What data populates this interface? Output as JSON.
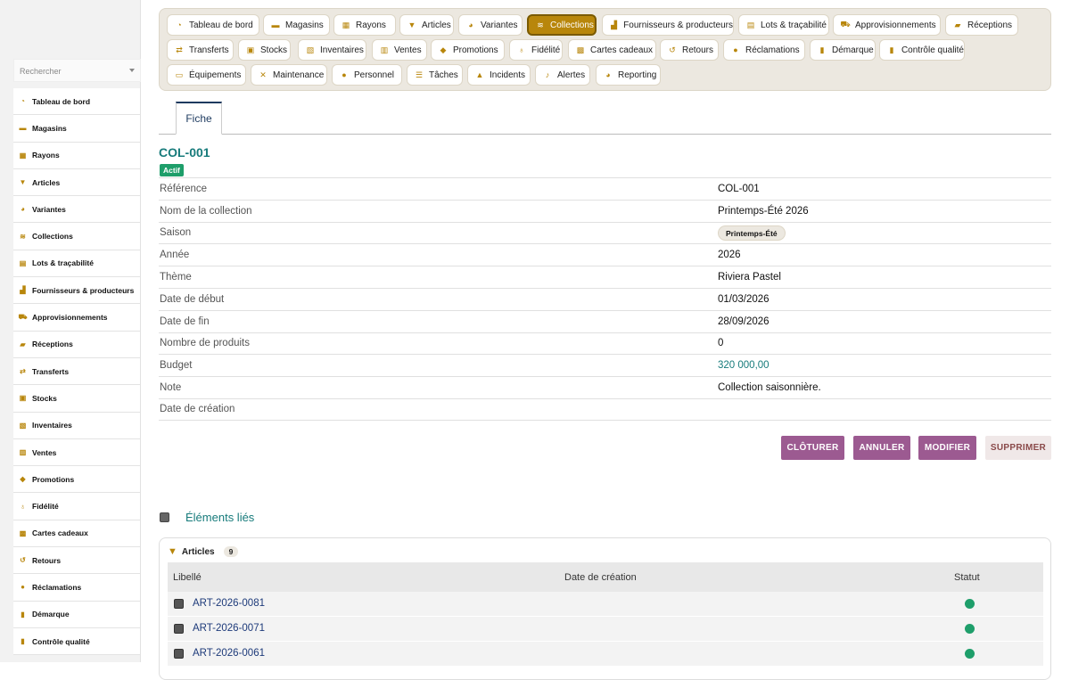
{
  "sidebar": {
    "search_placeholder": "Rechercher",
    "items": [
      {
        "label": "Tableau de bord",
        "icon": "gauge-icon",
        "glyph": "◔"
      },
      {
        "label": "Magasins",
        "icon": "store-icon",
        "glyph": "▬"
      },
      {
        "label": "Rayons",
        "icon": "grid-icon",
        "glyph": "▦"
      },
      {
        "label": "Articles",
        "icon": "shirt-icon",
        "glyph": "▼"
      },
      {
        "label": "Variantes",
        "icon": "palette-icon",
        "glyph": "◕"
      },
      {
        "label": "Collections",
        "icon": "layers-icon",
        "glyph": "≋"
      },
      {
        "label": "Lots & traçabilité",
        "icon": "barcode-icon",
        "glyph": "▤"
      },
      {
        "label": "Fournisseurs & producteurs",
        "icon": "factory-icon",
        "glyph": "▟"
      },
      {
        "label": "Approvisionnements",
        "icon": "cart-icon",
        "glyph": "⛟"
      },
      {
        "label": "Réceptions",
        "icon": "truck-icon",
        "glyph": "▰"
      },
      {
        "label": "Transferts",
        "icon": "arrows-icon",
        "glyph": "⇄"
      },
      {
        "label": "Stocks",
        "icon": "warehouse-icon",
        "glyph": "▣"
      },
      {
        "label": "Inventaires",
        "icon": "clipboard-check-icon",
        "glyph": "▧"
      },
      {
        "label": "Ventes",
        "icon": "register-icon",
        "glyph": "▥"
      },
      {
        "label": "Promotions",
        "icon": "tags-icon",
        "glyph": "◆"
      },
      {
        "label": "Fidélité",
        "icon": "award-icon",
        "glyph": "♁"
      },
      {
        "label": "Cartes cadeaux",
        "icon": "gift-icon",
        "glyph": "▩"
      },
      {
        "label": "Retours",
        "icon": "undo-icon",
        "glyph": "↺"
      },
      {
        "label": "Réclamations",
        "icon": "comment-icon",
        "glyph": "●"
      },
      {
        "label": "Démarque",
        "icon": "receipt-icon",
        "glyph": "▮"
      },
      {
        "label": "Contrôle qualité",
        "icon": "clipboard-icon",
        "glyph": "▮"
      }
    ]
  },
  "topnav": {
    "items": [
      {
        "label": "Tableau de bord",
        "icon": "gauge-icon",
        "glyph": "◔"
      },
      {
        "label": "Magasins",
        "icon": "store-icon",
        "glyph": "▬"
      },
      {
        "label": "Rayons",
        "icon": "grid-icon",
        "glyph": "▦"
      },
      {
        "label": "Articles",
        "icon": "shirt-icon",
        "glyph": "▼"
      },
      {
        "label": "Variantes",
        "icon": "palette-icon",
        "glyph": "◕"
      },
      {
        "label": "Collections",
        "icon": "layers-icon",
        "glyph": "≋",
        "active": true
      },
      {
        "label": "Fournisseurs & producteurs",
        "icon": "factory-icon",
        "glyph": "▟"
      },
      {
        "label": "Lots & traçabilité",
        "icon": "barcode-icon",
        "glyph": "▤"
      },
      {
        "label": "Approvisionnements",
        "icon": "cart-icon",
        "glyph": "⛟"
      },
      {
        "label": "Réceptions",
        "icon": "truck-icon",
        "glyph": "▰"
      },
      {
        "label": "Transferts",
        "icon": "arrows-icon",
        "glyph": "⇄"
      },
      {
        "label": "Stocks",
        "icon": "warehouse-icon",
        "glyph": "▣"
      },
      {
        "label": "Inventaires",
        "icon": "clipboard-check-icon",
        "glyph": "▧"
      },
      {
        "label": "Ventes",
        "icon": "register-icon",
        "glyph": "▥"
      },
      {
        "label": "Promotions",
        "icon": "tags-icon",
        "glyph": "◆"
      },
      {
        "label": "Fidélité",
        "icon": "award-icon",
        "glyph": "♁"
      },
      {
        "label": "Cartes cadeaux",
        "icon": "gift-icon",
        "glyph": "▩"
      },
      {
        "label": "Retours",
        "icon": "undo-icon",
        "glyph": "↺"
      },
      {
        "label": "Réclamations",
        "icon": "comment-icon",
        "glyph": "●"
      },
      {
        "label": "Démarque",
        "icon": "receipt-icon",
        "glyph": "▮"
      },
      {
        "label": "Contrôle qualité",
        "icon": "clipboard-icon",
        "glyph": "▮"
      },
      {
        "label": "Équipements",
        "icon": "monitor-icon",
        "glyph": "▭"
      },
      {
        "label": "Maintenance",
        "icon": "tools-icon",
        "glyph": "✕"
      },
      {
        "label": "Personnel",
        "icon": "users-icon",
        "glyph": "●"
      },
      {
        "label": "Tâches",
        "icon": "list-icon",
        "glyph": "☰"
      },
      {
        "label": "Incidents",
        "icon": "warning-icon",
        "glyph": "▲"
      },
      {
        "label": "Alertes",
        "icon": "bell-icon",
        "glyph": "♪"
      },
      {
        "label": "Reporting",
        "icon": "pie-chart-icon",
        "glyph": "◕"
      }
    ]
  },
  "tab": {
    "label": "Fiche"
  },
  "record": {
    "title": "COL-001",
    "status": "Actif",
    "fields": [
      {
        "label": "Référence",
        "value": "COL-001"
      },
      {
        "label": "Nom de la collection",
        "value": "Printemps-Été 2026"
      },
      {
        "label": "Saison",
        "value": "Printemps-Été",
        "chip": true
      },
      {
        "label": "Année",
        "value": "2026"
      },
      {
        "label": "Thème",
        "value": "Riviera Pastel"
      },
      {
        "label": "Date de début",
        "value": "01/03/2026"
      },
      {
        "label": "Date de fin",
        "value": "28/09/2026"
      },
      {
        "label": "Nombre de produits",
        "value": "0"
      },
      {
        "label": "Budget",
        "value": "320 000,00",
        "money": true
      },
      {
        "label": "Note",
        "value": "Collection saisonnière."
      },
      {
        "label": "Date de création",
        "value": ""
      }
    ]
  },
  "actions": {
    "cloturer": "CLÔTURER",
    "annuler": "ANNULER",
    "modifier": "MODIFIER",
    "supprimer": "SUPPRIMER"
  },
  "related": {
    "title": "Éléments liés",
    "panel": {
      "title": "Articles",
      "count": "9",
      "columns": [
        "Libellé",
        "Date de création",
        "Statut"
      ],
      "rows": [
        {
          "label": "ART-2026-0081",
          "date": "",
          "status_color": "#1e9e6a"
        },
        {
          "label": "ART-2026-0071",
          "date": "",
          "status_color": "#1e9e6a"
        },
        {
          "label": "ART-2026-0061",
          "date": "",
          "status_color": "#1e9e6a"
        }
      ]
    }
  },
  "colors": {
    "accent": "#b8860b",
    "teal": "#177b7b",
    "action": "#9c5a91",
    "success": "#1e9e6a"
  }
}
